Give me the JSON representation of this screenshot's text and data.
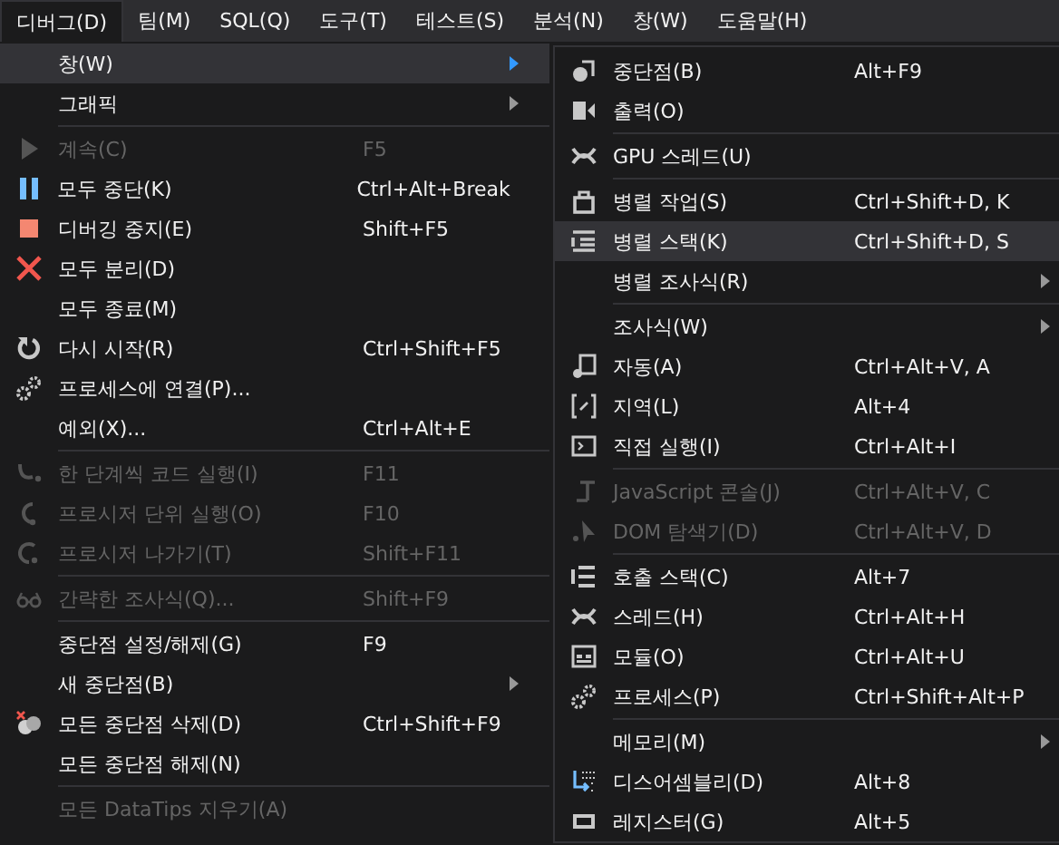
{
  "menubar": [
    {
      "label": "디버그(D)",
      "selected": true
    },
    {
      "label": "팀(M)",
      "selected": false
    },
    {
      "label": "SQL(Q)",
      "selected": false
    },
    {
      "label": "도구(T)",
      "selected": false
    },
    {
      "label": "테스트(S)",
      "selected": false
    },
    {
      "label": "분석(N)",
      "selected": false
    },
    {
      "label": "창(W)",
      "selected": false
    },
    {
      "label": "도움말(H)",
      "selected": false
    }
  ],
  "debug_menu": [
    {
      "kind": "item",
      "label": "창(W)",
      "selected": true,
      "disabled": false,
      "submenu": true
    },
    {
      "kind": "item",
      "label": "그래픽",
      "selected": false,
      "disabled": false,
      "submenu": true
    },
    {
      "kind": "separator"
    },
    {
      "kind": "item",
      "label": "계속(C)",
      "shortcut": "F5",
      "selected": false,
      "disabled": true,
      "submenu": false
    },
    {
      "kind": "item",
      "label": "모두 중단(K)",
      "shortcut": "Ctrl+Alt+Break",
      "selected": false,
      "disabled": false,
      "submenu": false
    },
    {
      "kind": "item",
      "label": "디버깅 중지(E)",
      "shortcut": "Shift+F5",
      "selected": false,
      "disabled": false,
      "submenu": false
    },
    {
      "kind": "item",
      "label": "모두 분리(D)",
      "selected": false,
      "disabled": false,
      "submenu": false
    },
    {
      "kind": "item",
      "label": "모두 종료(M)",
      "selected": false,
      "disabled": false,
      "submenu": false
    },
    {
      "kind": "item",
      "label": "다시 시작(R)",
      "shortcut": "Ctrl+Shift+F5",
      "selected": false,
      "disabled": false,
      "submenu": false
    },
    {
      "kind": "item",
      "label": "프로세스에 연결(P)...",
      "selected": false,
      "disabled": false,
      "submenu": false
    },
    {
      "kind": "item",
      "label": "예외(X)...",
      "shortcut": "Ctrl+Alt+E",
      "selected": false,
      "disabled": false,
      "submenu": false
    },
    {
      "kind": "separator"
    },
    {
      "kind": "item",
      "label": "한 단계씩 코드 실행(I)",
      "shortcut": "F11",
      "selected": false,
      "disabled": true,
      "submenu": false
    },
    {
      "kind": "item",
      "label": "프로시저 단위 실행(O)",
      "shortcut": "F10",
      "selected": false,
      "disabled": true,
      "submenu": false
    },
    {
      "kind": "item",
      "label": "프로시저 나가기(T)",
      "shortcut": "Shift+F11",
      "selected": false,
      "disabled": true,
      "submenu": false
    },
    {
      "kind": "separator"
    },
    {
      "kind": "item",
      "label": "간략한 조사식(Q)...",
      "shortcut": "Shift+F9",
      "selected": false,
      "disabled": true,
      "submenu": false
    },
    {
      "kind": "separator"
    },
    {
      "kind": "item",
      "label": "중단점 설정/해제(G)",
      "shortcut": "F9",
      "selected": false,
      "disabled": false,
      "submenu": false
    },
    {
      "kind": "item",
      "label": "새 중단점(B)",
      "selected": false,
      "disabled": false,
      "submenu": true
    },
    {
      "kind": "item",
      "label": "모든 중단점 삭제(D)",
      "shortcut": "Ctrl+Shift+F9",
      "selected": false,
      "disabled": false,
      "submenu": false
    },
    {
      "kind": "item",
      "label": "모든 중단점 해제(N)",
      "selected": false,
      "disabled": false,
      "submenu": false
    },
    {
      "kind": "separator"
    },
    {
      "kind": "item",
      "label": "모든 DataTips 지우기(A)",
      "selected": false,
      "disabled": true,
      "submenu": false
    }
  ],
  "window_submenu": [
    {
      "kind": "item",
      "label": "중단점(B)",
      "shortcut": "Alt+F9",
      "selected": false,
      "disabled": false,
      "submenu": false
    },
    {
      "kind": "item",
      "label": "출력(O)",
      "selected": false,
      "disabled": false,
      "submenu": false
    },
    {
      "kind": "separator"
    },
    {
      "kind": "item",
      "label": "GPU 스레드(U)",
      "selected": false,
      "disabled": false,
      "submenu": false
    },
    {
      "kind": "separator"
    },
    {
      "kind": "item",
      "label": "병렬 작업(S)",
      "shortcut": "Ctrl+Shift+D, K",
      "selected": false,
      "disabled": false,
      "submenu": false
    },
    {
      "kind": "item",
      "label": "병렬 스택(K)",
      "shortcut": "Ctrl+Shift+D, S",
      "selected": true,
      "disabled": false,
      "submenu": false
    },
    {
      "kind": "item",
      "label": "병렬 조사식(R)",
      "selected": false,
      "disabled": false,
      "submenu": true
    },
    {
      "kind": "separator"
    },
    {
      "kind": "item",
      "label": "조사식(W)",
      "selected": false,
      "disabled": false,
      "submenu": true
    },
    {
      "kind": "item",
      "label": "자동(A)",
      "shortcut": "Ctrl+Alt+V, A",
      "selected": false,
      "disabled": false,
      "submenu": false
    },
    {
      "kind": "item",
      "label": "지역(L)",
      "shortcut": "Alt+4",
      "selected": false,
      "disabled": false,
      "submenu": false
    },
    {
      "kind": "item",
      "label": "직접 실행(I)",
      "shortcut": "Ctrl+Alt+I",
      "selected": false,
      "disabled": false,
      "submenu": false
    },
    {
      "kind": "separator"
    },
    {
      "kind": "item",
      "label": "JavaScript 콘솔(J)",
      "shortcut": "Ctrl+Alt+V, C",
      "selected": false,
      "disabled": true,
      "submenu": false
    },
    {
      "kind": "item",
      "label": "DOM 탐색기(D)",
      "shortcut": "Ctrl+Alt+V, D",
      "selected": false,
      "disabled": true,
      "submenu": false
    },
    {
      "kind": "separator"
    },
    {
      "kind": "item",
      "label": "호출 스택(C)",
      "shortcut": "Alt+7",
      "selected": false,
      "disabled": false,
      "submenu": false
    },
    {
      "kind": "item",
      "label": "스레드(H)",
      "shortcut": "Ctrl+Alt+H",
      "selected": false,
      "disabled": false,
      "submenu": false
    },
    {
      "kind": "item",
      "label": "모듈(O)",
      "shortcut": "Ctrl+Alt+U",
      "selected": false,
      "disabled": false,
      "submenu": false
    },
    {
      "kind": "item",
      "label": "프로세스(P)",
      "shortcut": "Ctrl+Shift+Alt+P",
      "selected": false,
      "disabled": false,
      "submenu": false
    },
    {
      "kind": "separator"
    },
    {
      "kind": "item",
      "label": "메모리(M)",
      "selected": false,
      "disabled": false,
      "submenu": true
    },
    {
      "kind": "item",
      "label": "디스어셈블리(D)",
      "shortcut": "Alt+8",
      "selected": false,
      "disabled": false,
      "submenu": false
    },
    {
      "kind": "item",
      "label": "레지스터(G)",
      "shortcut": "Alt+5",
      "selected": false,
      "disabled": false,
      "submenu": false
    }
  ]
}
